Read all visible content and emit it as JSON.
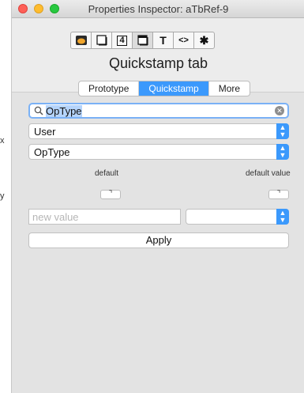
{
  "window": {
    "title": "Properties Inspector: aTbRef-9"
  },
  "toolbar": {
    "buttons": [
      {
        "icon": "appearance-icon"
      },
      {
        "icon": "note-icon"
      },
      {
        "icon": "number-icon",
        "label": "4"
      },
      {
        "icon": "window-icon"
      },
      {
        "icon": "text-icon",
        "label": "T"
      },
      {
        "icon": "code-icon",
        "label": "<>"
      },
      {
        "icon": "gear-icon"
      }
    ]
  },
  "heading": "Quickstamp tab",
  "tabs": [
    {
      "label": "Prototype",
      "active": false
    },
    {
      "label": "Quickstamp",
      "active": true
    },
    {
      "label": "More",
      "active": false
    }
  ],
  "search": {
    "value": "OpType"
  },
  "category_popup": {
    "value": "User"
  },
  "attribute_popup": {
    "value": "OpType"
  },
  "default_label": "default",
  "default_value_label": "default value",
  "value_input": {
    "value": "",
    "placeholder": "new value"
  },
  "value_popup": {
    "value": ""
  },
  "apply_label": "Apply",
  "edge_chars": {
    "x": "x",
    "y": "y"
  },
  "colors": {
    "accent": "#3b99fc",
    "close": "#fe5f57",
    "minimize": "#febc2e",
    "zoom": "#28c840"
  }
}
